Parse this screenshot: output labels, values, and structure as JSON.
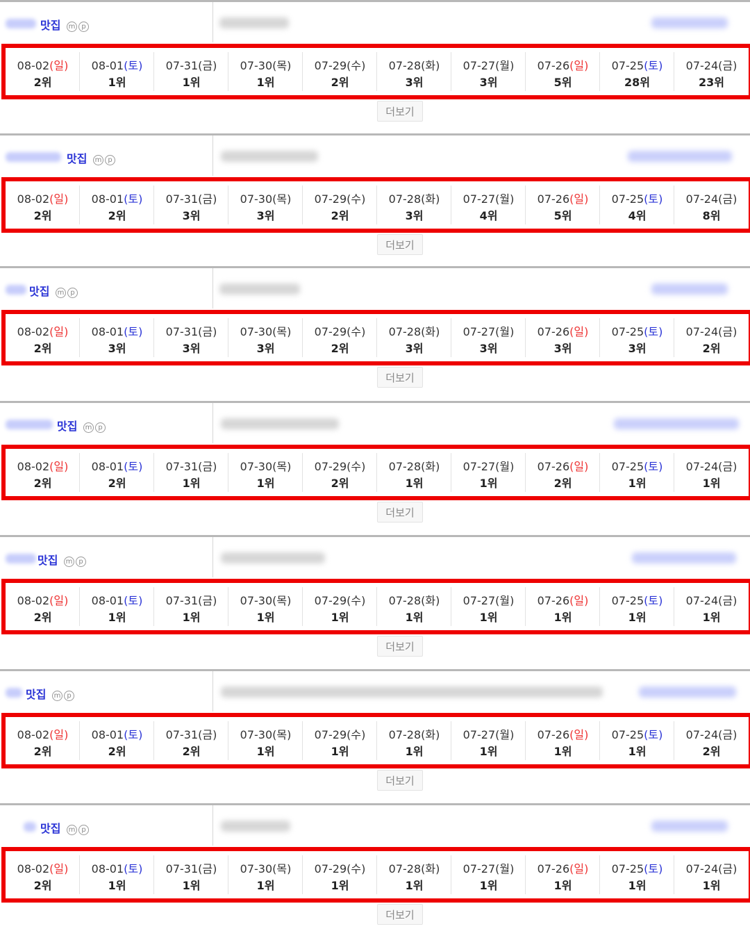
{
  "keyword": "맛집",
  "mp_icons": [
    "m",
    "p"
  ],
  "more_label": "더보기",
  "colors": {
    "frame": "#ee0000",
    "sunday": "#e33333",
    "saturday": "#2b34d6",
    "keyword": "#2b34d6"
  },
  "dates": [
    {
      "date": "08-02",
      "day": "일",
      "type": "sun"
    },
    {
      "date": "08-01",
      "day": "토",
      "type": "sat"
    },
    {
      "date": "07-31",
      "day": "금",
      "type": "wk"
    },
    {
      "date": "07-30",
      "day": "목",
      "type": "wk"
    },
    {
      "date": "07-29",
      "day": "수",
      "type": "wk"
    },
    {
      "date": "07-28",
      "day": "화",
      "type": "wk"
    },
    {
      "date": "07-27",
      "day": "월",
      "type": "wk"
    },
    {
      "date": "07-26",
      "day": "일",
      "type": "sun"
    },
    {
      "date": "07-25",
      "day": "토",
      "type": "sat"
    },
    {
      "date": "07-24",
      "day": "금",
      "type": "wk"
    }
  ],
  "blocks": [
    {
      "ranks": [
        "2위",
        "1위",
        "1위",
        "1위",
        "2위",
        "3위",
        "3위",
        "5위",
        "28위",
        "23위"
      ]
    },
    {
      "ranks": [
        "2위",
        "2위",
        "3위",
        "3위",
        "2위",
        "3위",
        "4위",
        "5위",
        "4위",
        "8위"
      ]
    },
    {
      "ranks": [
        "2위",
        "3위",
        "3위",
        "3위",
        "2위",
        "3위",
        "3위",
        "3위",
        "3위",
        "2위"
      ]
    },
    {
      "ranks": [
        "2위",
        "2위",
        "1위",
        "1위",
        "2위",
        "1위",
        "1위",
        "2위",
        "1위",
        "1위"
      ]
    },
    {
      "ranks": [
        "2위",
        "1위",
        "1위",
        "1위",
        "1위",
        "1위",
        "1위",
        "1위",
        "1위",
        "1위"
      ]
    },
    {
      "ranks": [
        "2위",
        "2위",
        "2위",
        "1위",
        "1위",
        "1위",
        "1위",
        "1위",
        "1위",
        "2위"
      ]
    },
    {
      "ranks": [
        "2위",
        "1위",
        "1위",
        "1위",
        "1위",
        "1위",
        "1위",
        "1위",
        "1위",
        "1위"
      ]
    }
  ]
}
